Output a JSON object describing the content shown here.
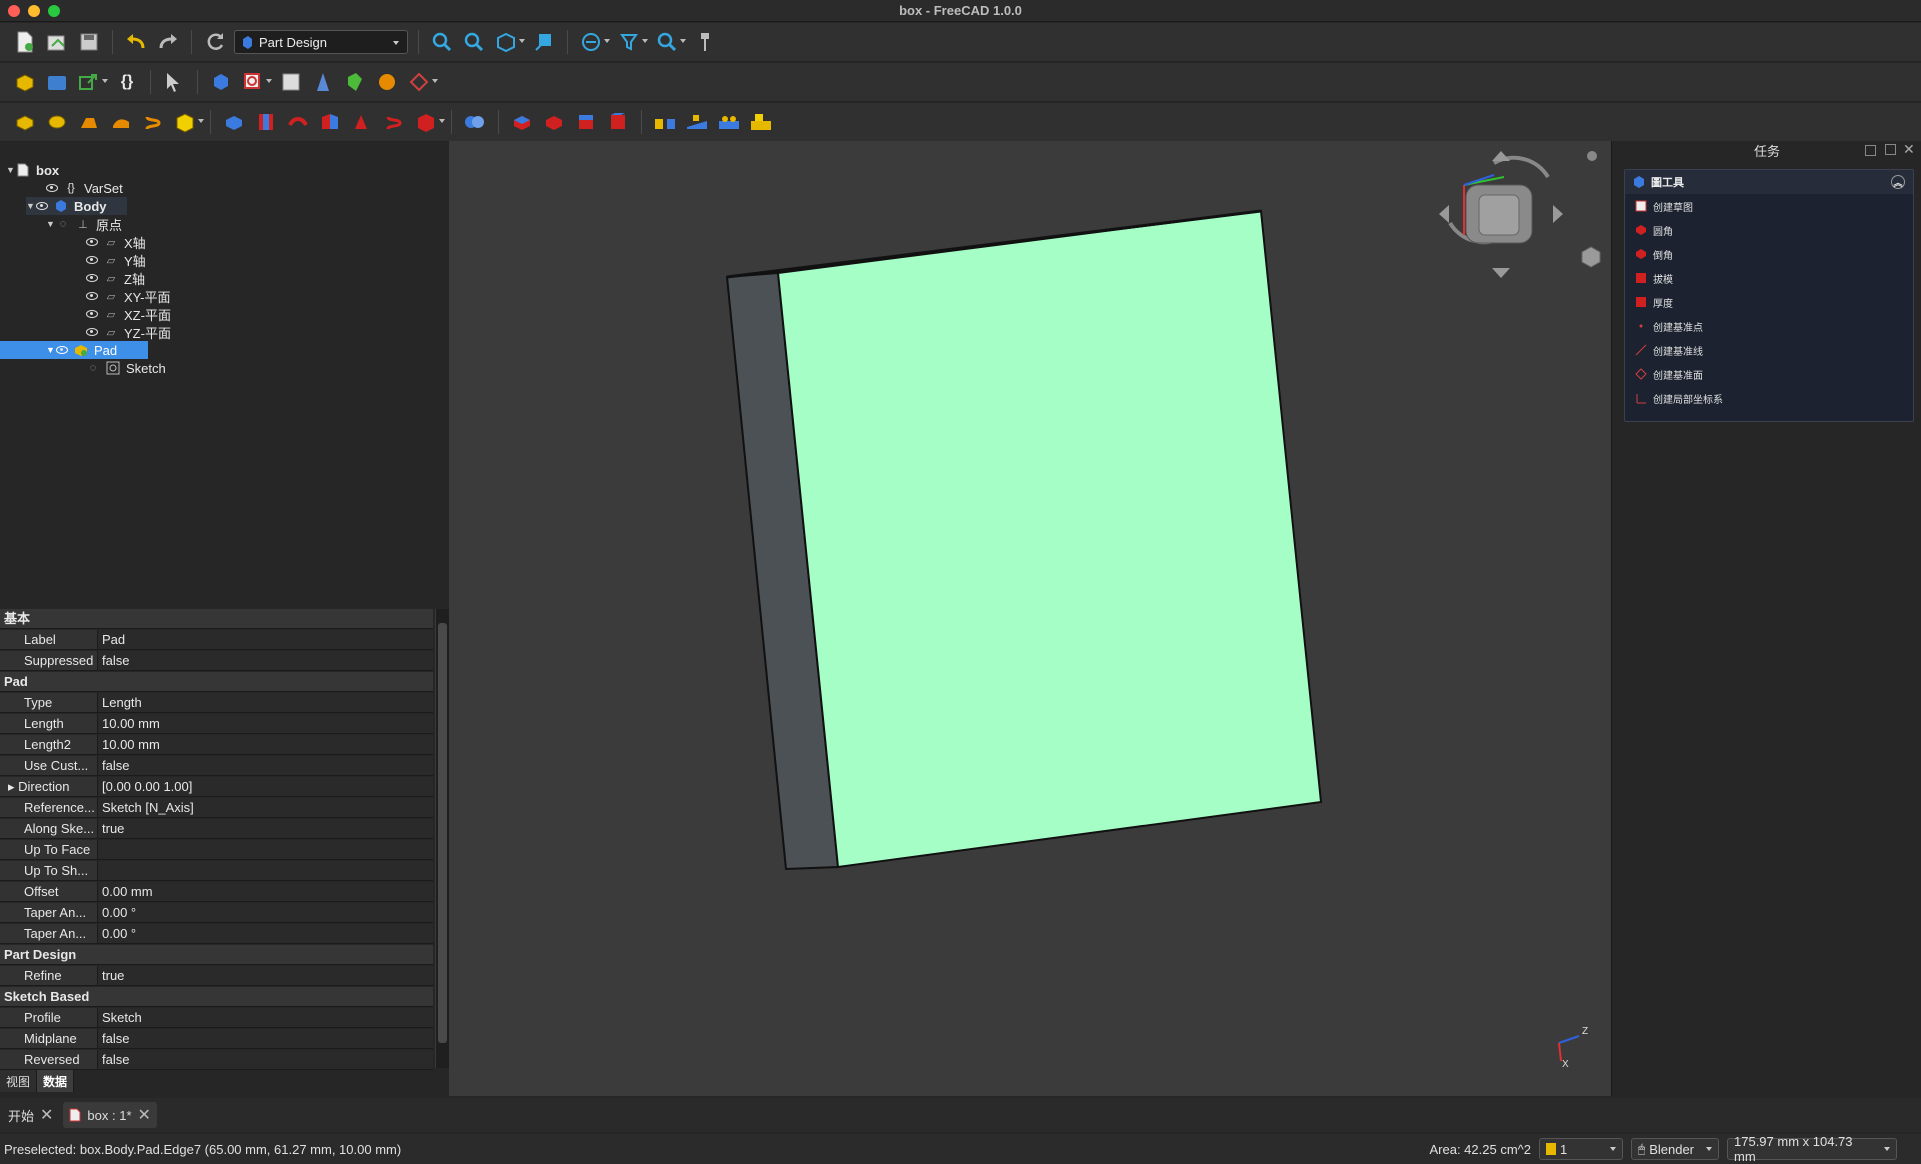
{
  "window": {
    "title": "box - FreeCAD 1.0.0"
  },
  "toolbar": {
    "workbench": "Part Design"
  },
  "tree": {
    "items": [
      {
        "label": "box"
      },
      {
        "label": "VarSet",
        "prefix": "{}"
      },
      {
        "label": "Body"
      },
      {
        "label": "原点"
      },
      {
        "label": "X轴"
      },
      {
        "label": "Y轴"
      },
      {
        "label": "Z轴"
      },
      {
        "label": "XY-平面"
      },
      {
        "label": "XZ-平面"
      },
      {
        "label": "YZ-平面"
      },
      {
        "label": "Pad"
      },
      {
        "label": "Sketch"
      }
    ]
  },
  "properties": {
    "rows": [
      {
        "group": "基本"
      },
      {
        "key": "Label",
        "value": "Pad"
      },
      {
        "key": "Suppressed",
        "value": "false"
      },
      {
        "group": "Pad"
      },
      {
        "key": "Type",
        "value": "Length"
      },
      {
        "key": "Length",
        "value": "10.00 mm"
      },
      {
        "key": "Length2",
        "value": "10.00 mm"
      },
      {
        "key": "Use Cust...",
        "value": "false"
      },
      {
        "key": "Direction",
        "value": "[0.00 0.00 1.00]"
      },
      {
        "key": "Reference...",
        "value": "Sketch [N_Axis]"
      },
      {
        "key": "Along Ske...",
        "value": "true"
      },
      {
        "key": "Up To Face",
        "value": ""
      },
      {
        "key": "Up To Sh...",
        "value": ""
      },
      {
        "key": "Offset",
        "value": "0.00 mm"
      },
      {
        "key": "Taper An...",
        "value": "0.00 °"
      },
      {
        "key": "Taper An...",
        "value": "0.00 °"
      },
      {
        "group": "Part Design"
      },
      {
        "key": "Refine",
        "value": "true"
      },
      {
        "group": "Sketch Based"
      },
      {
        "key": "Profile",
        "value": "Sketch"
      },
      {
        "key": "Midplane",
        "value": "false"
      },
      {
        "key": "Reversed",
        "value": "false"
      }
    ]
  },
  "left_tabs": [
    "视图",
    "数据"
  ],
  "task": {
    "header": "任务",
    "panel_title": "圖工具",
    "items": [
      "创建草图",
      "圆角",
      "倒角",
      "拔模",
      "厚度",
      "创建基准点",
      "创建基准线",
      "创建基准面",
      "创建局部坐标系"
    ]
  },
  "doc_tabs": {
    "start": "开始",
    "doc": "box : 1*"
  },
  "status": {
    "preselected": "Preselected: box.Body.Pad.Edge7 (65.00 mm, 61.27 mm, 10.00 mm)",
    "area": "Area: 42.25 cm^2",
    "count": "1",
    "nav_style": "Blender",
    "dimensions": "175.97 mm x 104.73 mm"
  },
  "viewport": {
    "axis_labels": [
      "Z",
      "X"
    ],
    "colors": {
      "face": "#a6fec7",
      "side": "#4c5155",
      "background": "#3b3b3b"
    }
  }
}
